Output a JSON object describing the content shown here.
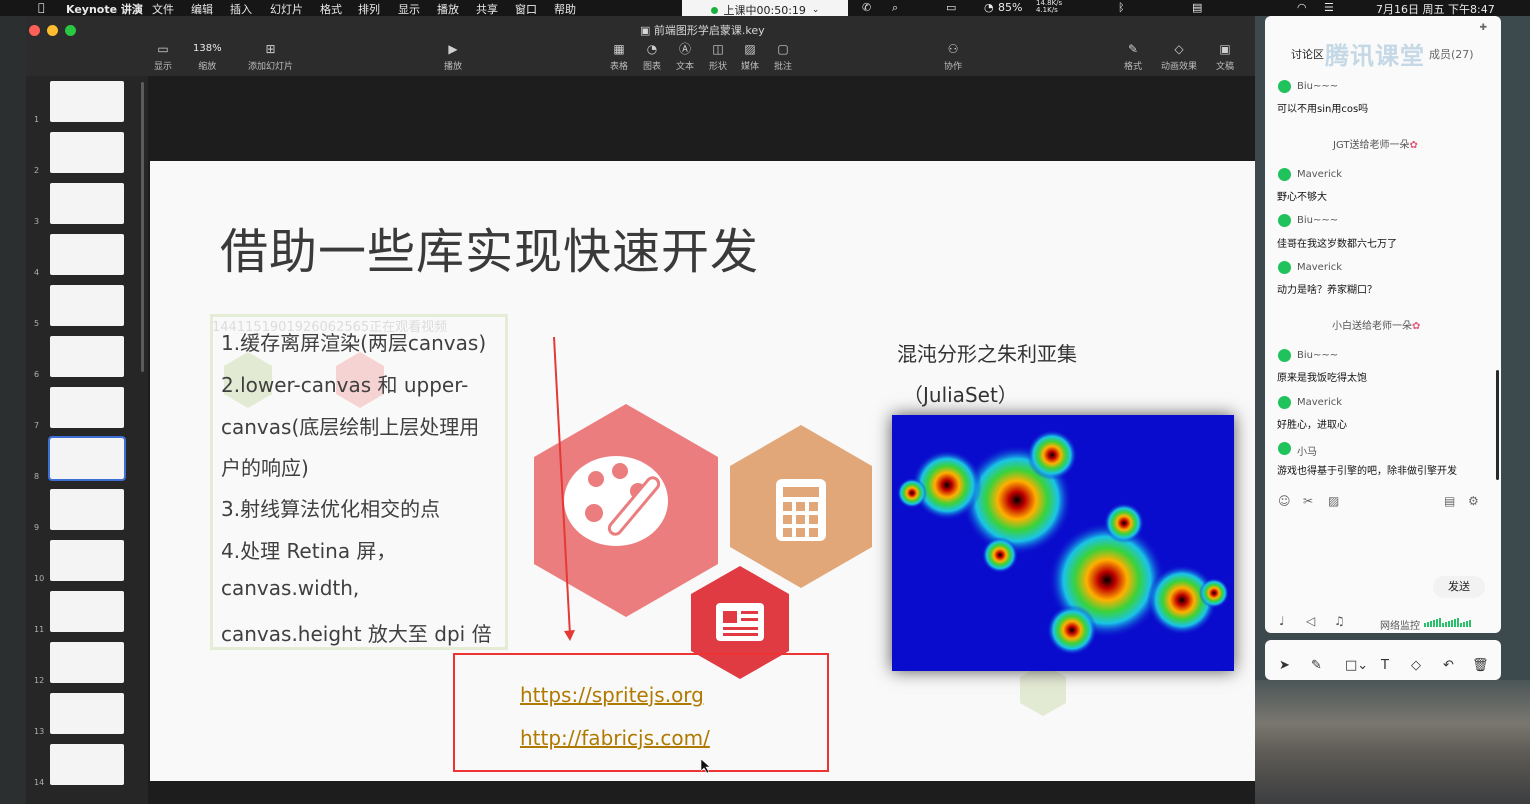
{
  "menubar": {
    "items": [
      "Keynote 讲演",
      "文件",
      "编辑",
      "插入",
      "幻灯片",
      "格式",
      "排列",
      "显示",
      "播放",
      "共享",
      "窗口",
      "帮助"
    ],
    "battery": "85%",
    "net_up": "14.8K/s",
    "net_down": "4.1K/s",
    "datetime": "7月16日 周五 下午8:47"
  },
  "recording": {
    "label": "上课中00:50:19"
  },
  "window": {
    "title": "前端图形学启蒙课.key"
  },
  "toolbar": {
    "view": "显示",
    "zoom_value": "138%",
    "zoom": "缩放",
    "add_slide": "添加幻灯片",
    "play": "播放",
    "table": "表格",
    "chart": "图表",
    "text": "文本",
    "shape": "形状",
    "media": "媒体",
    "comment": "批注",
    "collaborate": "协作",
    "format": "格式",
    "animate": "动画效果",
    "document": "文稿"
  },
  "navigator": {
    "numbers": [
      "1",
      "2",
      "3",
      "4",
      "5",
      "6",
      "7",
      "8",
      "9",
      "10",
      "11",
      "12",
      "13",
      "14"
    ],
    "selected": "8"
  },
  "slide": {
    "title": "借助一些库实现快速开发",
    "watermark": "1441151901926062565正在观看视频",
    "bullets": [
      "1.缓存离屏渲染(两层canvas)",
      "2.lower-canvas 和 upper-",
      "canvas(底层绘制上层处理用",
      "户的响应)",
      "3.射线算法优化相交的点",
      "4.处理 Retina 屏，",
      "canvas.width,",
      "canvas.height 放大至 dpi 倍"
    ],
    "julia_title": "混沌分形之朱利亚集",
    "julia_sub": "（JuliaSet）",
    "links": [
      "https://spritejs.org",
      "http://fabricjs.com/"
    ],
    "colors": {
      "hex_red": "#ec7d7f",
      "hex_orange": "#e2a779",
      "hex_darkred": "#e03a43",
      "julia_bg": "#0a0ccd"
    }
  },
  "chat": {
    "tab_discussion": "讨论区",
    "tab_members": "成员(27)",
    "brand": "腾讯课堂",
    "messages": [
      {
        "user": "Biu~~~",
        "text": "可以不用sin用cos吗"
      },
      {
        "gift": "JGT送给老师一朵"
      },
      {
        "user": "Maverick",
        "text": "野心不够大"
      },
      {
        "user": "Biu~~~",
        "text": "佳哥在我这岁数都六七万了"
      },
      {
        "user": "Maverick",
        "text": "动力是啥？养家糊口？"
      },
      {
        "gift": "小白送给老师一朵"
      },
      {
        "user": "Biu~~~",
        "text": "原来是我饭吃得太饱"
      },
      {
        "user": "Maverick",
        "text": "好胜心，进取心"
      },
      {
        "user": "小马",
        "text": "游戏也得基于引擎的吧，除非做引擎开发"
      }
    ],
    "send": "发送",
    "network": "网络监控"
  }
}
